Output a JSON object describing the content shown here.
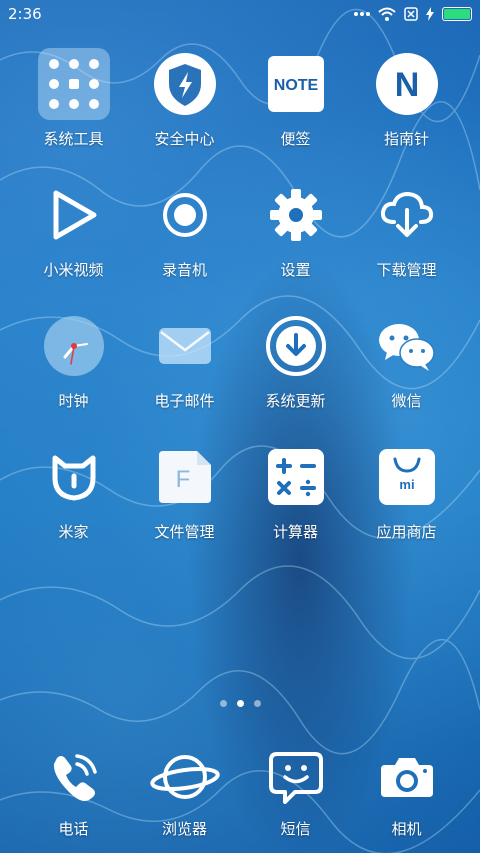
{
  "status_bar": {
    "time": "2:36",
    "battery_level": 1.0,
    "battery_color": "#2ddc7a",
    "icons": [
      "more-dots-icon",
      "wifi-icon",
      "no-sim-icon",
      "charging-icon",
      "battery-icon"
    ]
  },
  "apps": [
    {
      "label": "系统工具",
      "icon": "system-tools-folder-icon"
    },
    {
      "label": "安全中心",
      "icon": "security-shield-icon"
    },
    {
      "label": "便签",
      "icon": "notes-icon",
      "icon_text": "NOTE"
    },
    {
      "label": "指南针",
      "icon": "compass-icon",
      "icon_text": "N"
    },
    {
      "label": "小米视频",
      "icon": "video-play-icon"
    },
    {
      "label": "录音机",
      "icon": "recorder-icon"
    },
    {
      "label": "设置",
      "icon": "settings-gear-icon"
    },
    {
      "label": "下载管理",
      "icon": "download-cloud-icon"
    },
    {
      "label": "时钟",
      "icon": "clock-icon"
    },
    {
      "label": "电子邮件",
      "icon": "email-icon"
    },
    {
      "label": "系统更新",
      "icon": "system-update-icon"
    },
    {
      "label": "微信",
      "icon": "wechat-icon"
    },
    {
      "label": "米家",
      "icon": "mijia-icon"
    },
    {
      "label": "文件管理",
      "icon": "file-manager-icon",
      "icon_text": "F"
    },
    {
      "label": "计算器",
      "icon": "calculator-icon"
    },
    {
      "label": "应用商店",
      "icon": "app-store-icon",
      "icon_text": "mi"
    }
  ],
  "page_indicator": {
    "count": 3,
    "active": 2
  },
  "dock": [
    {
      "label": "电话",
      "icon": "phone-icon"
    },
    {
      "label": "浏览器",
      "icon": "browser-planet-icon"
    },
    {
      "label": "短信",
      "icon": "messages-icon"
    },
    {
      "label": "相机",
      "icon": "camera-icon"
    }
  ]
}
